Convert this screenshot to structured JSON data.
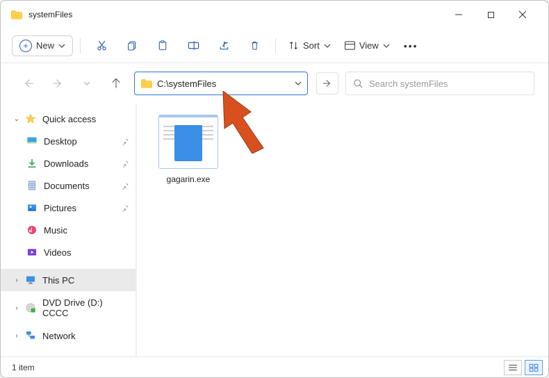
{
  "titlebar": {
    "title": "systemFiles"
  },
  "toolbar": {
    "new_label": "New",
    "sort_label": "Sort",
    "view_label": "View"
  },
  "navbar": {
    "address": "C:\\systemFiles",
    "search_placeholder": "Search systemFiles"
  },
  "sidebar": {
    "quick_access": "Quick access",
    "items": [
      {
        "label": "Desktop"
      },
      {
        "label": "Downloads"
      },
      {
        "label": "Documents"
      },
      {
        "label": "Pictures"
      },
      {
        "label": "Music"
      },
      {
        "label": "Videos"
      }
    ],
    "this_pc": "This PC",
    "dvd": "DVD Drive (D:) CCCC",
    "network": "Network"
  },
  "content": {
    "files": [
      {
        "name": "gagarin.exe"
      }
    ]
  },
  "statusbar": {
    "count": "1 item"
  }
}
